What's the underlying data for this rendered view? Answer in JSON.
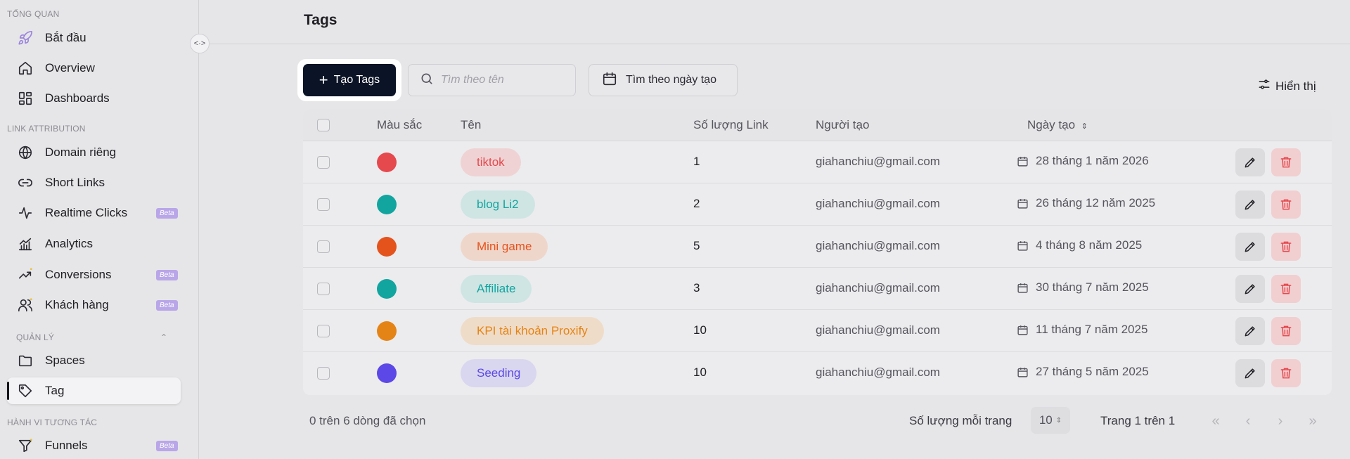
{
  "sidebar": {
    "sections": [
      {
        "label": "TỔNG QUAN"
      },
      {
        "label": "LINK ATTRIBUTION"
      },
      {
        "label": "QUẢN LÝ"
      },
      {
        "label": "HÀNH VI TƯƠNG TÁC"
      }
    ],
    "items": [
      {
        "label": "Bắt đầu",
        "icon": "rocket-icon"
      },
      {
        "label": "Overview",
        "icon": "home-icon"
      },
      {
        "label": "Dashboards",
        "icon": "dashboard-icon"
      },
      {
        "label": "Domain riêng",
        "icon": "globe-icon"
      },
      {
        "label": "Short Links",
        "icon": "link-icon"
      },
      {
        "label": "Realtime Clicks",
        "icon": "activity-icon",
        "badge": "Beta"
      },
      {
        "label": "Analytics",
        "icon": "chart-icon"
      },
      {
        "label": "Conversions",
        "icon": "trending-up-icon",
        "badge": "Beta"
      },
      {
        "label": "Khách hàng",
        "icon": "users-icon",
        "badge": "Beta"
      },
      {
        "label": "Spaces",
        "icon": "folder-icon"
      },
      {
        "label": "Tag",
        "icon": "tag-icon",
        "active": true
      },
      {
        "label": "Funnels",
        "icon": "filter-icon",
        "badge": "Beta"
      }
    ],
    "toggle_glyph": "<·>"
  },
  "header": {
    "title": "Tags"
  },
  "toolbar": {
    "create_label": "Tạo Tags",
    "search_placeholder": "Tìm theo tên",
    "date_filter_label": "Tìm theo ngày tạo",
    "display_label": "Hiển thị"
  },
  "table": {
    "columns": {
      "color": "Màu sắc",
      "name": "Tên",
      "link_count": "Số lượng Link",
      "creator": "Người tạo",
      "created_at": "Ngày tạo"
    },
    "rows": [
      {
        "color": "#e5484d",
        "bg": "#efd3d4",
        "name": "tiktok",
        "link_count": "1",
        "creator": "giahanchiu@gmail.com",
        "created_at": "28 tháng 1 năm 2026"
      },
      {
        "color": "#12a5a0",
        "bg": "#cfe5e3",
        "name": "blog Li2",
        "link_count": "2",
        "creator": "giahanchiu@gmail.com",
        "created_at": "26 tháng 12 năm 2025"
      },
      {
        "color": "#e5531c",
        "bg": "#efd6cb",
        "name": "Mini game",
        "link_count": "5",
        "creator": "giahanchiu@gmail.com",
        "created_at": "4 tháng 8 năm 2025"
      },
      {
        "color": "#12a5a0",
        "bg": "#cfe5e3",
        "name": "Affiliate",
        "link_count": "3",
        "creator": "giahanchiu@gmail.com",
        "created_at": "30 tháng 7 năm 2025"
      },
      {
        "color": "#e58416",
        "bg": "#efdcc8",
        "name": "KPI tài khoản Proxify",
        "link_count": "10",
        "creator": "giahanchiu@gmail.com",
        "created_at": "11 tháng 7 năm 2025"
      },
      {
        "color": "#5b48e6",
        "bg": "#d9d6ef",
        "name": "Seeding",
        "link_count": "10",
        "creator": "giahanchiu@gmail.com",
        "created_at": "27 tháng 5 năm 2025"
      }
    ]
  },
  "footer": {
    "selected_info": "0 trên 6 dòng đã chọn",
    "per_page_label": "Số lượng mỗi trang",
    "per_page_value": "10",
    "page_info": "Trang 1 trên 1",
    "pager": {
      "first": "«",
      "prev": "‹",
      "next": "›",
      "last": "»"
    }
  }
}
